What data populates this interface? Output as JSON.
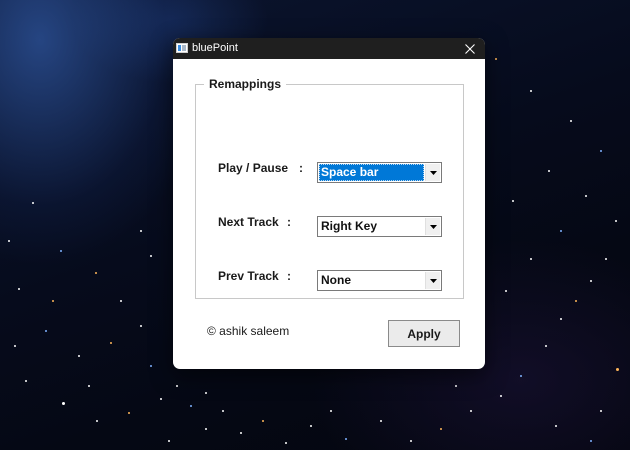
{
  "window": {
    "title": "bluePoint",
    "close_icon": "close-icon",
    "app_icon": "app-icon"
  },
  "remappings": {
    "group_title": "Remappings",
    "rows": [
      {
        "label": "Play / Pause",
        "separator": ":",
        "value": "Space bar",
        "focused": true
      },
      {
        "label": "Next Track",
        "separator": ":",
        "value": "Right Key",
        "focused": false
      },
      {
        "label": "Prev Track",
        "separator": ":",
        "value": "None",
        "focused": false
      }
    ]
  },
  "footer": {
    "copyright": "© ashik saleem",
    "apply_label": "Apply"
  },
  "colors": {
    "titlebar": "#1f1f1f",
    "selection": "#0078d7",
    "window_bg": "#ffffff"
  }
}
